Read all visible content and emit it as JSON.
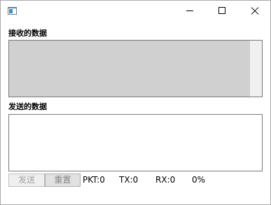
{
  "window": {
    "icon": "app-window-icon",
    "controls": [
      "minimize-icon",
      "maximize-icon",
      "close-icon"
    ]
  },
  "receive": {
    "label": "接收的数据",
    "value": ""
  },
  "send": {
    "label": "发送的数据",
    "value": ""
  },
  "buttons": {
    "send_label": "发送",
    "reset_label": "重置"
  },
  "status": {
    "pkt": "PKT:0",
    "tx": "TX:0",
    "rx": "RX:0",
    "percent": "0%"
  },
  "colors": {
    "receive_bg": "#d0d0d0",
    "button_bg": "#e1e1e1",
    "disabled_text": "#a0a0a0"
  }
}
